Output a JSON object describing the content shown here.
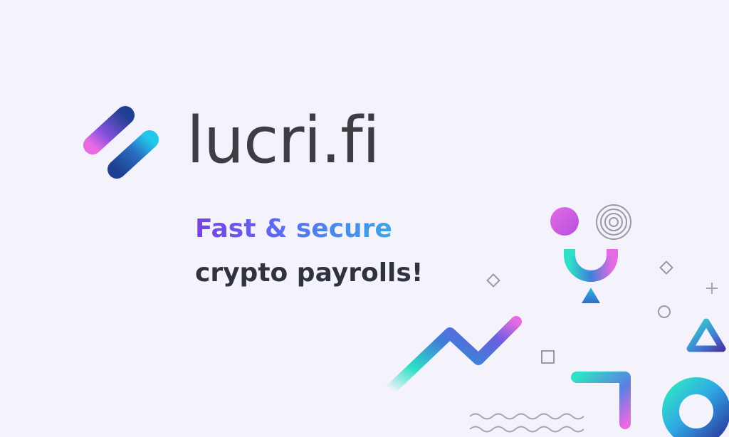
{
  "brand": {
    "name": "lucri.fi",
    "logo_icon": "slanted-bars-logo-icon"
  },
  "tagline": {
    "line1": "Fast & secure",
    "line2": "crypto payrolls!"
  },
  "colors": {
    "background": "#f4f2fb",
    "wordmark": "#3f3d44",
    "accent_purple": "#7b3fe4",
    "accent_blue": "#3aa6e6",
    "accent_teal": "#2fe0c6",
    "accent_pink": "#e66be0",
    "navy": "#1d3f8f",
    "text_dark": "#2f3340"
  },
  "decorations": [
    "pink-circle-icon",
    "concentric-circles-icon",
    "magnet-arc-icon",
    "triangle-icon",
    "diamond-icon",
    "plus-icon",
    "ring-icon",
    "outlined-triangle-icon",
    "zigzag-line-icon",
    "square-icon",
    "corner-bracket-icon",
    "wave-lines-icon",
    "donut-ring-icon"
  ]
}
